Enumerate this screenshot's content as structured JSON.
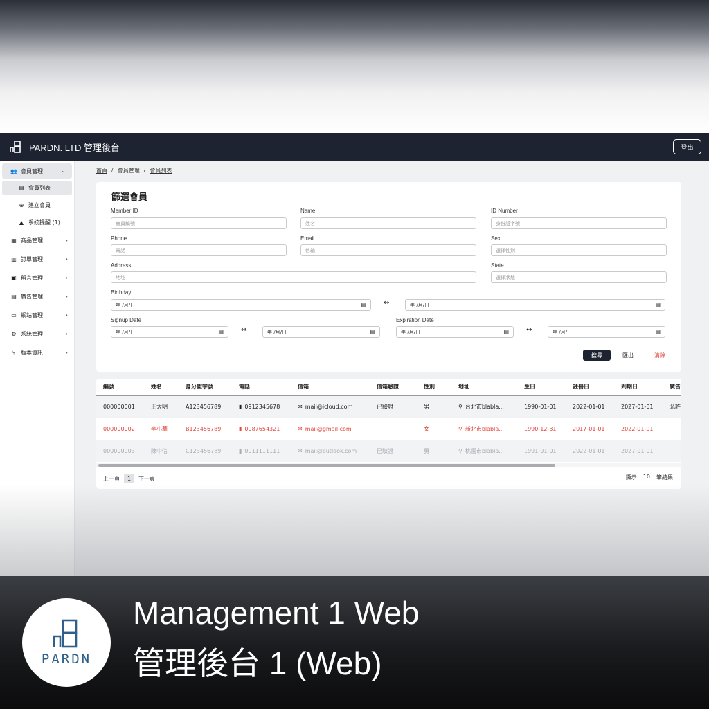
{
  "app": {
    "title": "PARDN. LTD 管理後台",
    "logout_label": "登出"
  },
  "sidebar": {
    "groups": [
      {
        "label": "會員管理",
        "icon": "users-icon"
      },
      {
        "label": "商品管理",
        "icon": "boxes-icon"
      },
      {
        "label": "訂單管理",
        "icon": "clipboard-icon"
      },
      {
        "label": "留言管理",
        "icon": "inbox-icon"
      },
      {
        "label": "廣告管理",
        "icon": "ad-icon"
      },
      {
        "label": "網站管理",
        "icon": "monitor-icon"
      },
      {
        "label": "系統管理",
        "icon": "user-gear-icon"
      },
      {
        "label": "版本資訊",
        "icon": "branch-icon"
      }
    ],
    "member_sub": [
      {
        "label": "會員列表"
      },
      {
        "label": "建立會員"
      },
      {
        "label": "系統提醒 (1)"
      }
    ]
  },
  "breadcrumb": {
    "home": "首頁",
    "section": "會員管理",
    "current": "會員列表",
    "sep": "/"
  },
  "filter": {
    "title": "篩選會員",
    "member_id": {
      "label": "Member ID",
      "placeholder": "會員編號"
    },
    "name": {
      "label": "Name",
      "placeholder": "姓名"
    },
    "id_number": {
      "label": "ID Number",
      "placeholder": "身份證字號"
    },
    "phone": {
      "label": "Phone",
      "placeholder": "電話"
    },
    "email": {
      "label": "Email",
      "placeholder": "信箱"
    },
    "sex": {
      "label": "Sex",
      "placeholder": "選擇性別"
    },
    "address": {
      "label": "Address",
      "placeholder": "地址"
    },
    "state": {
      "label": "State",
      "placeholder": "選擇狀態"
    },
    "birthday": {
      "label": "Birthday"
    },
    "signup": {
      "label": "Signup Date"
    },
    "expiration": {
      "label": "Expiration Date"
    },
    "date_placeholder": "年 /月/日",
    "search_label": "搜尋",
    "export_label": "匯出",
    "clear_label": "清除"
  },
  "table": {
    "headers": [
      "編號",
      "姓名",
      "身分證字號",
      "電話",
      "信箱",
      "信箱驗證",
      "性別",
      "地址",
      "生日",
      "註冊日",
      "到期日",
      "廣告"
    ],
    "rows": [
      [
        "000000001",
        "王大明",
        "A123456789",
        "0912345678",
        "mail@icloud.com",
        "已驗證",
        "男",
        "台北市blabla...",
        "1990-01-01",
        "2022-01-01",
        "2027-01-01",
        "允許"
      ],
      [
        "000000002",
        "李小華",
        "B123456789",
        "0987654321",
        "mail@gmail.com",
        "",
        "女",
        "新北市blabla...",
        "1990-12-31",
        "2017-01-01",
        "2022-01-01",
        ""
      ],
      [
        "000000003",
        "陳中信",
        "C123456789",
        "0911111111",
        "mail@outlook.com",
        "已驗證",
        "男",
        "桃園市blabla...",
        "1991-01-01",
        "2022-01-01",
        "2027-01-01",
        ""
      ]
    ]
  },
  "pagination": {
    "prev": "上一頁",
    "page": "1",
    "next": "下一頁",
    "show": "顯示",
    "per_page": "10",
    "unit": "筆結果"
  },
  "banner": {
    "title_en": "Management 1 Web",
    "title_zh": "管理後台 1 (Web)",
    "badge_text": "PARDN"
  },
  "colors": {
    "navbar": "#1d2331",
    "accent_red": "#e0443a",
    "badge_blue": "#2f5f8a"
  }
}
